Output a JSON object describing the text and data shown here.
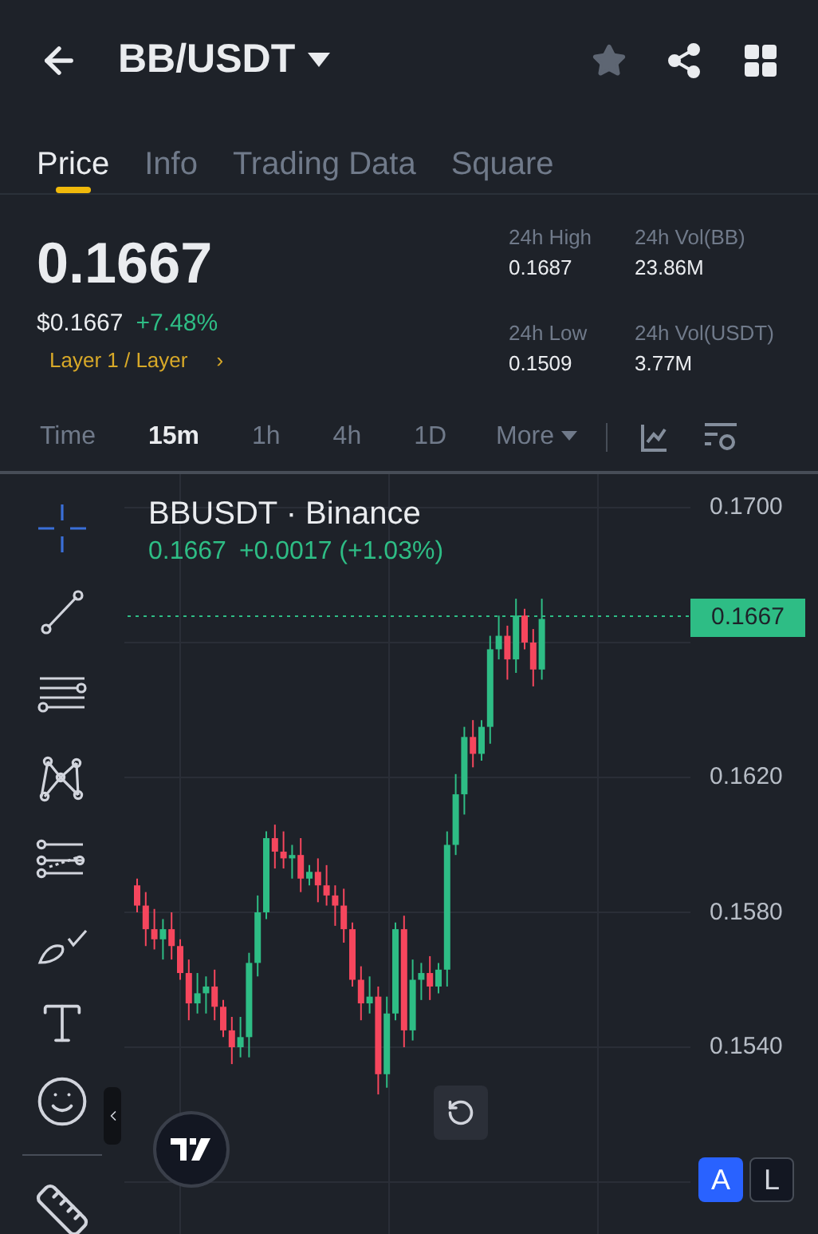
{
  "header": {
    "pair": "BB/USDT"
  },
  "tabs": [
    {
      "label": "Price",
      "selected": true
    },
    {
      "label": "Info",
      "selected": false
    },
    {
      "label": "Trading Data",
      "selected": false
    },
    {
      "label": "Square",
      "selected": false
    }
  ],
  "ticker": {
    "price": "0.1667",
    "usd_price": "$0.1667",
    "change": "+7.48%",
    "category": "Layer 1 / Layer",
    "category_arrow": "›"
  },
  "stats": [
    {
      "label": "24h High",
      "value": "0.1687"
    },
    {
      "label": "24h Vol(BB)",
      "value": "23.86M"
    },
    {
      "label": "24h Low",
      "value": "0.1509"
    },
    {
      "label": "24h Vol(USDT)",
      "value": "3.77M"
    }
  ],
  "intervals": [
    {
      "label": "Time",
      "selected": false
    },
    {
      "label": "15m",
      "selected": true
    },
    {
      "label": "1h",
      "selected": false
    },
    {
      "label": "4h",
      "selected": false
    },
    {
      "label": "1D",
      "selected": false
    }
  ],
  "more_label": "More",
  "chart": {
    "symbol": "BBUSDT · Binance",
    "last": "0.1667",
    "change": "+0.0017 (+1.03%)",
    "current_price": "0.1667",
    "price_axis": [
      "0.1700",
      "0.1620",
      "0.1580",
      "0.1540"
    ]
  },
  "scale_buttons": [
    {
      "label": "A",
      "selected": true
    },
    {
      "label": "L",
      "selected": false
    }
  ]
}
